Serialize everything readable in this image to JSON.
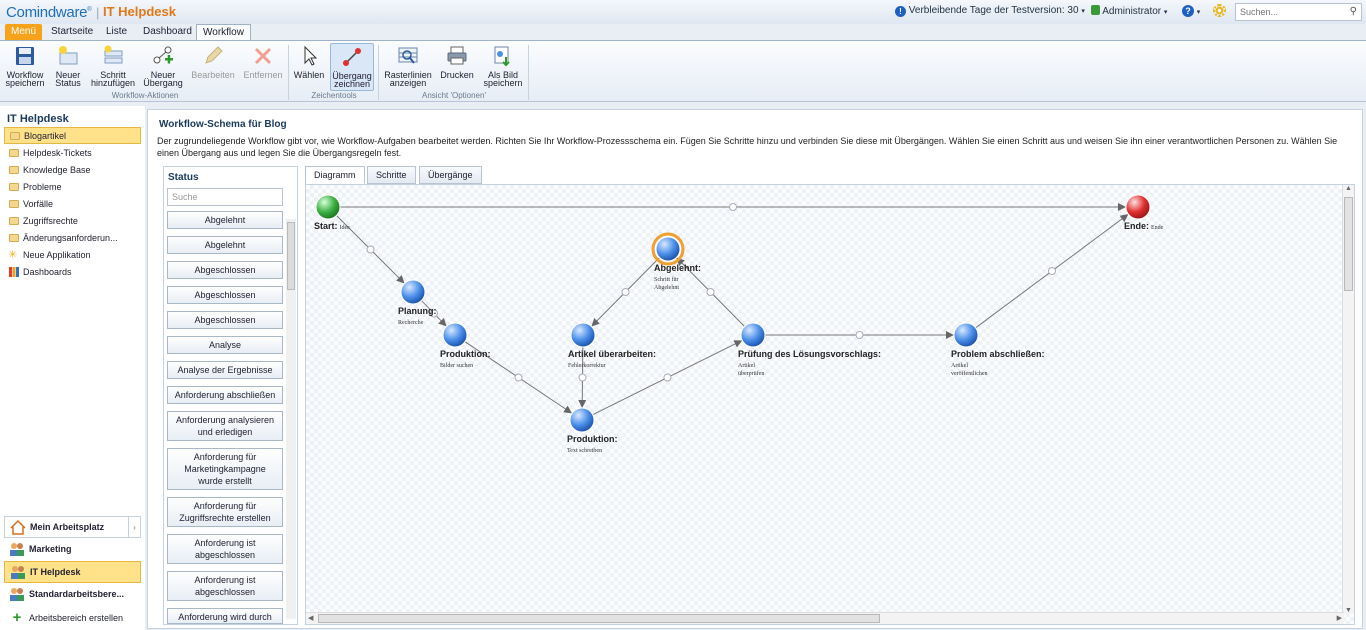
{
  "header": {
    "logo": "Comindware",
    "logo_mark": "®",
    "app_title": "IT Helpdesk",
    "trial_text": "Verbleibende Tage der Testversion: 30",
    "user": "Administrator",
    "search_placeholder": "Suchen..."
  },
  "tabs": [
    "Menü",
    "Startseite",
    "Liste",
    "Dashboard",
    "Workflow"
  ],
  "ribbon": {
    "buttons": [
      {
        "line1": "Workflow",
        "line2": "speichern"
      },
      {
        "line1": "Neuer",
        "line2": "Status"
      },
      {
        "line1": "Schritt",
        "line2": "hinzufügen"
      },
      {
        "line1": "Neuer",
        "line2": "Übergang"
      },
      {
        "line1": "Bearbeiten",
        "line2": ""
      },
      {
        "line1": "Entfernen",
        "line2": ""
      },
      {
        "line1": "Wählen",
        "line2": ""
      },
      {
        "line1": "Übergang",
        "line2": "zeichnen"
      },
      {
        "line1": "Rasterlinien",
        "line2": "anzeigen"
      },
      {
        "line1": "Drucken",
        "line2": ""
      },
      {
        "line1": "Als Bild",
        "line2": "speichern"
      }
    ],
    "groups": [
      "Workflow-Aktionen",
      "Zeichentools",
      "Ansicht 'Optionen'"
    ]
  },
  "sidebar": {
    "title": "IT Helpdesk",
    "items": [
      "Blogartikel",
      "Helpdesk-Tickets",
      "Knowledge Base",
      "Probleme",
      "Vorfälle",
      "Zugriffsrechte",
      "Änderungsanforderun...",
      "Neue Applikation",
      "Dashboards"
    ],
    "workspaces": [
      "Mein Arbeitsplatz",
      "Marketing",
      "IT Helpdesk",
      "Standardarbeitsbere..."
    ],
    "create_workspace": "Arbeitsbereich erstellen"
  },
  "main": {
    "title": "Workflow-Schema für Blog",
    "description": "Der zugrundeliegende Workflow gibt vor, wie Workflow-Aufgaben bearbeitet werden. Richten Sie Ihr Workflow-Prozessschema ein. Fügen Sie Schritte hinzu und verbinden Sie diese mit Übergängen. Wählen Sie einen Schritt aus und weisen Sie ihn einer verantwortlichen Personen zu. Wählen Sie einen Übergang aus und legen Sie die Übergangsregeln fest."
  },
  "status_panel": {
    "title": "Status",
    "search_placeholder": "Suche",
    "items": [
      "Abgelehnt",
      "Abgelehnt",
      "Abgeschlossen",
      "Abgeschlossen",
      "Abgeschlossen",
      "Analyse",
      "Analyse der Ergebnisse",
      "Anforderung abschließen",
      "Anforderung analysieren und erledigen",
      "Anforderung für Marketingkampagne wurde erstellt",
      "Anforderung für Zugriffsrechte erstellen",
      "Anforderung ist abgeschlossen",
      "Anforderung ist abgeschlossen",
      "Anforderung wird durch"
    ]
  },
  "diagram_tabs": [
    "Diagramm",
    "Schritte",
    "Übergänge"
  ],
  "diagram": {
    "nodes": [
      {
        "id": "start",
        "name": "Start:",
        "desc": [
          "Idee"
        ],
        "color": "#3cb043"
      },
      {
        "id": "ende",
        "name": "Ende:",
        "desc": [
          "Ende"
        ],
        "color": "#e03030"
      },
      {
        "id": "planung",
        "name": "Planung:",
        "desc": [
          "Recherche"
        ],
        "color": "#4a8ee8"
      },
      {
        "id": "prod1",
        "name": "Produktion:",
        "desc": [
          "Bilder suchen"
        ],
        "color": "#4a8ee8"
      },
      {
        "id": "prod2",
        "name": "Produktion:",
        "desc": [
          "Text schreiben"
        ],
        "color": "#4a8ee8"
      },
      {
        "id": "artikel",
        "name": "Artikel überarbeiten:",
        "desc": [
          "Fehlerkorrektur"
        ],
        "color": "#4a8ee8"
      },
      {
        "id": "abgelehnt",
        "name": "Abgelehnt:",
        "desc": [
          "Schritt für",
          "Abgelehnt"
        ],
        "color": "#4a8ee8",
        "highlight": "#f0a030"
      },
      {
        "id": "pruefung",
        "name": "Prüfung des Lösungsvorschlags:",
        "desc": [
          "Artikel",
          "überprüfen"
        ],
        "color": "#4a8ee8"
      },
      {
        "id": "abschliessen",
        "name": "Problem abschließen:",
        "desc": [
          "Artikel",
          "veröffentlichen"
        ],
        "color": "#4a8ee8"
      }
    ],
    "edges": [
      [
        "start",
        "ende"
      ],
      [
        "start",
        "planung"
      ],
      [
        "planung",
        "prod1"
      ],
      [
        "prod1",
        "prod2"
      ],
      [
        "prod2",
        "pruefung"
      ],
      [
        "pruefung",
        "abgelehnt"
      ],
      [
        "abgelehnt",
        "artikel"
      ],
      [
        "artikel",
        "prod2"
      ],
      [
        "pruefung",
        "abschliessen"
      ],
      [
        "abschliessen",
        "ende"
      ]
    ]
  }
}
